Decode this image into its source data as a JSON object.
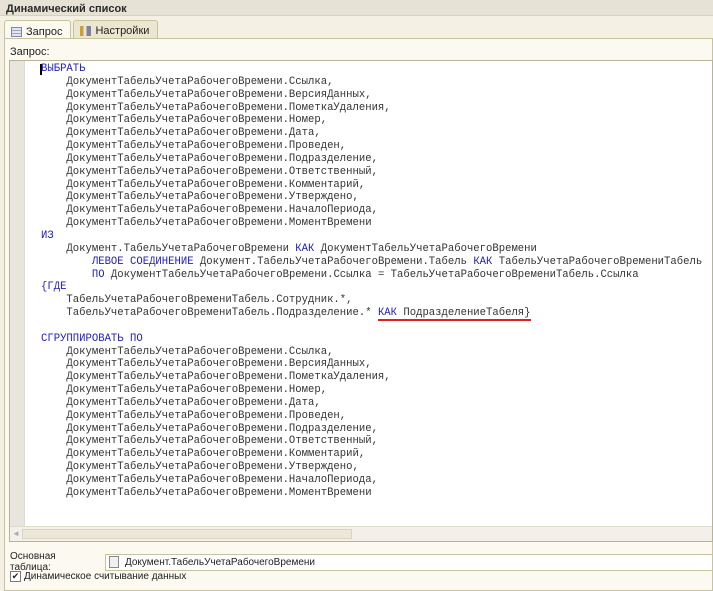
{
  "window": {
    "title": "Динамический список"
  },
  "tabs": [
    {
      "label": "Запрос",
      "icon": "table-icon",
      "active": true
    },
    {
      "label": "Настройки",
      "icon": "settings-icon",
      "active": false
    }
  ],
  "query_label": "Запрос:",
  "code_lines": [
    [
      {
        "t": "ВЫБРАТЬ",
        "kw": true
      }
    ],
    [
      {
        "t": "    ДокументТабельУчетаРабочегоВремени.Ссылка,"
      }
    ],
    [
      {
        "t": "    ДокументТабельУчетаРабочегоВремени.ВерсияДанных,"
      }
    ],
    [
      {
        "t": "    ДокументТабельУчетаРабочегоВремени.ПометкаУдаления,"
      }
    ],
    [
      {
        "t": "    ДокументТабельУчетаРабочегоВремени.Номер,"
      }
    ],
    [
      {
        "t": "    ДокументТабельУчетаРабочегоВремени.Дата,"
      }
    ],
    [
      {
        "t": "    ДокументТабельУчетаРабочегоВремени.Проведен,"
      }
    ],
    [
      {
        "t": "    ДокументТабельУчетаРабочегоВремени.Подразделение,"
      }
    ],
    [
      {
        "t": "    ДокументТабельУчетаРабочегоВремени.Ответственный,"
      }
    ],
    [
      {
        "t": "    ДокументТабельУчетаРабочегоВремени.Комментарий,"
      }
    ],
    [
      {
        "t": "    ДокументТабельУчетаРабочегоВремени.Утверждено,"
      }
    ],
    [
      {
        "t": "    ДокументТабельУчетаРабочегоВремени.НачалоПериода,"
      }
    ],
    [
      {
        "t": "    ДокументТабельУчетаРабочегоВремени.МоментВремени"
      }
    ],
    [
      {
        "t": "ИЗ",
        "kw": true
      }
    ],
    [
      {
        "t": "    Документ.ТабельУчетаРабочегоВремени "
      },
      {
        "t": "КАК",
        "kw": true
      },
      {
        "t": " ДокументТабельУчетаРабочегоВремени"
      }
    ],
    [
      {
        "t": "        "
      },
      {
        "t": "ЛЕВОЕ СОЕДИНЕНИЕ",
        "kw": true
      },
      {
        "t": " Документ.ТабельУчетаРабочегоВремени.Табель "
      },
      {
        "t": "КАК",
        "kw": true
      },
      {
        "t": " ТабельУчетаРабочегоВремениТабель"
      }
    ],
    [
      {
        "t": "        "
      },
      {
        "t": "ПО",
        "kw": true
      },
      {
        "t": " ДокументТабельУчетаРабочегоВремени.Ссылка = ТабельУчетаРабочегоВремениТабель.Ссылка"
      }
    ],
    [
      {
        "t": "{ГДЕ",
        "kw": true
      }
    ],
    [
      {
        "t": "    ТабельУчетаРабочегоВремениТабель.Сотрудник.*,"
      }
    ],
    [
      {
        "t": "    ТабельУчетаРабочегоВремениТабель.Подразделение.* "
      },
      {
        "t": "КАК",
        "kw": true,
        "ul": true
      },
      {
        "t": " ПодразделениеТабеля}",
        "ul": true
      }
    ],
    [
      {
        "t": ""
      }
    ],
    [
      {
        "t": "СГРУППИРОВАТЬ ПО",
        "kw": true
      }
    ],
    [
      {
        "t": "    ДокументТабельУчетаРабочегоВремени.Ссылка,"
      }
    ],
    [
      {
        "t": "    ДокументТабельУчетаРабочегоВремени.ВерсияДанных,"
      }
    ],
    [
      {
        "t": "    ДокументТабельУчетаРабочегоВремени.ПометкаУдаления,"
      }
    ],
    [
      {
        "t": "    ДокументТабельУчетаРабочегоВремени.Номер,"
      }
    ],
    [
      {
        "t": "    ДокументТабельУчетаРабочегоВремени.Дата,"
      }
    ],
    [
      {
        "t": "    ДокументТабельУчетаРабочегоВремени.Проведен,"
      }
    ],
    [
      {
        "t": "    ДокументТабельУчетаРабочегоВремени.Подразделение,"
      }
    ],
    [
      {
        "t": "    ДокументТабельУчетаРабочегоВремени.Ответственный,"
      }
    ],
    [
      {
        "t": "    ДокументТабельУчетаРабочегоВремени.Комментарий,"
      }
    ],
    [
      {
        "t": "    ДокументТабельУчетаРабочегоВремени.Утверждено,"
      }
    ],
    [
      {
        "t": "    ДокументТабельУчетаРабочегоВремени.НачалоПериода,"
      }
    ],
    [
      {
        "t": "    ДокументТабельУчетаРабочегоВремени.МоментВремени"
      }
    ]
  ],
  "colors": {
    "keyword": "#2020c0",
    "underline": "#e02020"
  },
  "main_table": {
    "label": "Основная таблица:",
    "value": "Документ.ТабельУчетаРабочегоВремени"
  },
  "dynamic_read": {
    "label": "Динамическое считывание данных",
    "checked": true
  }
}
